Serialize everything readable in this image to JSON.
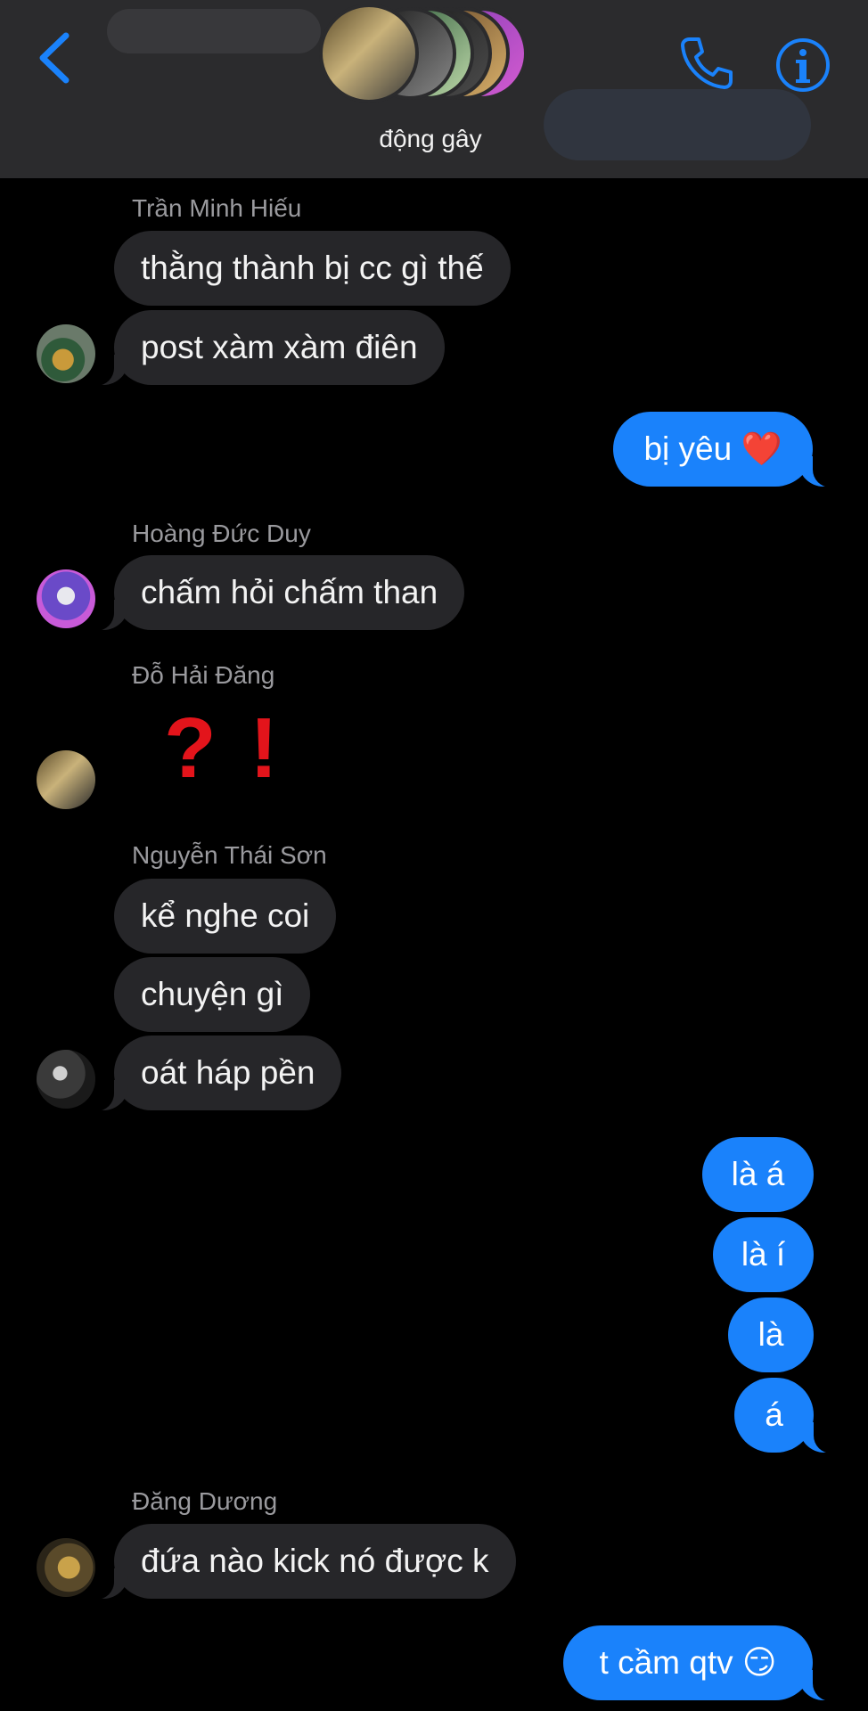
{
  "header": {
    "title": "động gây",
    "back_icon": "chevron-left-icon",
    "call_icon": "phone-icon",
    "info_icon": "info-icon",
    "accent": "#1a82fb"
  },
  "messages": {
    "hieu": {
      "sender": "Trần Minh Hiếu",
      "m1": "thằng thành bị cc gì thế",
      "m2": "post xàm xàm điên"
    },
    "me1": "bị yêu ❤️",
    "duy": {
      "sender": "Hoàng Đức Duy",
      "m1": "chấm hỏi chấm than"
    },
    "dang": {
      "sender": "Đỗ Hải Đăng",
      "q": "?",
      "e": "!"
    },
    "son": {
      "sender": "Nguyễn Thái Sơn",
      "m1": "kể nghe coi",
      "m2": "chuyện gì",
      "m3": "oát háp pền"
    },
    "me2": {
      "m1": "là á",
      "m2": "là í",
      "m3": "là",
      "m4": "á"
    },
    "duong": {
      "sender": "Đăng Dương",
      "m1": "đứa nào kick nó được k"
    },
    "me3": "t cầm qtv 😏"
  },
  "colors": {
    "background": "#000000",
    "header_bg": "#2b2b2d",
    "incoming_bubble": "#262629",
    "outgoing_bubble": "#1a82fb"
  }
}
